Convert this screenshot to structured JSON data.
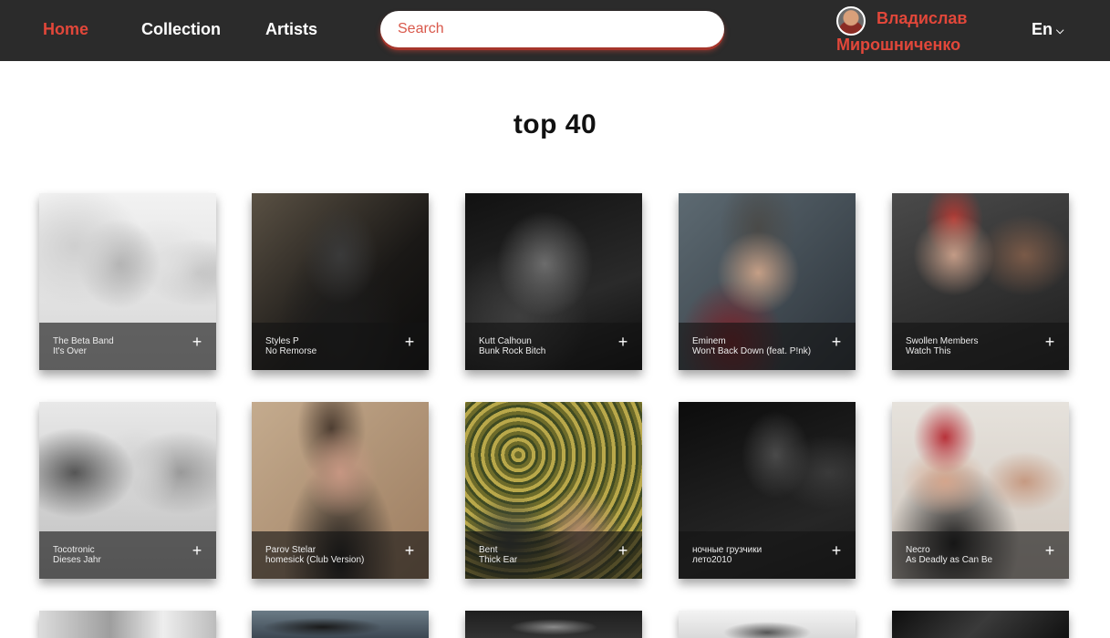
{
  "nav": {
    "home": "Home",
    "collection": "Collection",
    "artists": "Artists"
  },
  "search": {
    "placeholder": "Search",
    "value": ""
  },
  "user": {
    "first_name": "Владислав",
    "last_name": "Мирошниченко"
  },
  "language": {
    "selected": "En",
    "icon": "chevron-down-icon"
  },
  "page": {
    "title": "top 40"
  },
  "colors": {
    "accent": "#e2473a",
    "header_bg": "#2b2b2b",
    "page_bg": "#ffffff"
  },
  "tracks": [
    {
      "artist": "The Beta Band",
      "title": "It's Over"
    },
    {
      "artist": "Styles P",
      "title": "No Remorse"
    },
    {
      "artist": "Kutt Calhoun",
      "title": "Bunk Rock Bitch"
    },
    {
      "artist": "Eminem",
      "title": "Won't Back Down (feat. P!nk)"
    },
    {
      "artist": "Swollen Members",
      "title": "Watch This"
    },
    {
      "artist": "Tocotronic",
      "title": "Dieses Jahr"
    },
    {
      "artist": "Parov Stelar",
      "title": "homesick (Club Version)"
    },
    {
      "artist": "Bent",
      "title": "Thick Ear"
    },
    {
      "artist": "ночные грузчики",
      "title": "лето2010"
    },
    {
      "artist": "Necro",
      "title": "As Deadly as Can Be"
    }
  ],
  "add_icon": "plus-icon"
}
